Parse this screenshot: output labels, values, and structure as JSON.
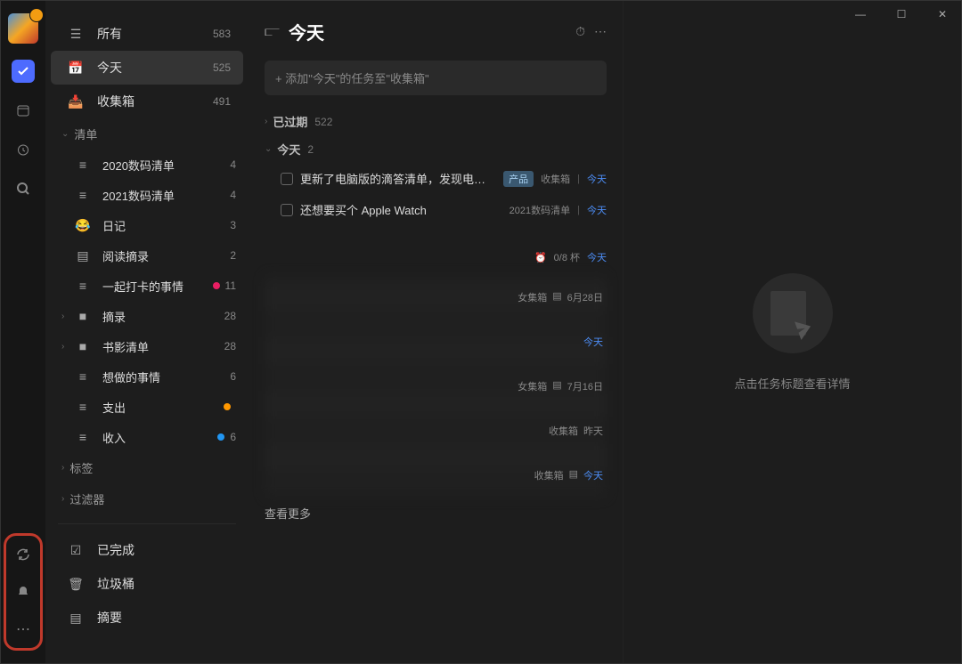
{
  "activity": {
    "items": [
      "check",
      "calendar",
      "clock",
      "search"
    ],
    "bottom": [
      "sync",
      "bell",
      "more"
    ]
  },
  "smart_lists": [
    {
      "icon": "☰",
      "label": "所有",
      "count": "583"
    },
    {
      "icon": "📅",
      "label": "今天",
      "count": "525",
      "active": true,
      "day": "29"
    },
    {
      "icon": "📥",
      "label": "收集箱",
      "count": "491"
    }
  ],
  "section_lists_label": "清单",
  "lists": [
    {
      "icon": "≡",
      "label": "2020数码清单",
      "count": "4"
    },
    {
      "icon": "≡",
      "label": "2021数码清单",
      "count": "4"
    },
    {
      "icon": "😂",
      "label": "日记",
      "count": "3"
    },
    {
      "icon": "▤",
      "label": "阅读摘录",
      "count": "2"
    },
    {
      "icon": "≡",
      "label": "一起打卡的事情",
      "count": "11",
      "dot": "pink"
    },
    {
      "icon": "■",
      "label": "摘录",
      "count": "28",
      "expandable": true
    },
    {
      "icon": "■",
      "label": "书影清单",
      "count": "28",
      "expandable": true
    },
    {
      "icon": "≡",
      "label": "想做的事情",
      "count": "6"
    },
    {
      "icon": "≡",
      "label": "支出",
      "count": "",
      "dot": "orange"
    },
    {
      "icon": "≡",
      "label": "收入",
      "count": "6",
      "dot": "blue"
    }
  ],
  "tags_label": "标签",
  "filters_label": "过滤器",
  "footer": [
    {
      "icon": "☑",
      "label": "已完成"
    },
    {
      "icon": "🗑",
      "label": "垃圾桶"
    },
    {
      "icon": "▤",
      "label": "摘要"
    }
  ],
  "panel": {
    "title": "今天",
    "add_placeholder": "+ 添加\"今天\"的任务至\"收集箱\"",
    "groups": [
      {
        "label": "已过期",
        "count": "522",
        "collapsed": true
      },
      {
        "label": "今天",
        "count": "2",
        "collapsed": false
      }
    ],
    "tasks": [
      {
        "title": "更新了电脑版的滴答清单，发现电脑版的也改",
        "tag": "产品",
        "list": "收集箱",
        "date": "今天"
      },
      {
        "title": "还想要买个 Apple Watch",
        "list": "2021数码清单",
        "date": "今天"
      }
    ],
    "habit": {
      "progress": "0/8 杯",
      "date": "今天"
    },
    "blurred_meta": [
      {
        "list": "女集箱",
        "icon": "▤",
        "date": "6月28日"
      },
      {
        "date": "今天"
      },
      {
        "list": "女集箱",
        "icon": "▤",
        "date": "7月16日"
      },
      {
        "list": "收集箱",
        "date": "昨天"
      },
      {
        "list": "收集箱",
        "icon": "▤",
        "date": "今天"
      }
    ],
    "view_more": "查看更多"
  },
  "detail": {
    "empty_text": "点击任务标题查看详情"
  }
}
